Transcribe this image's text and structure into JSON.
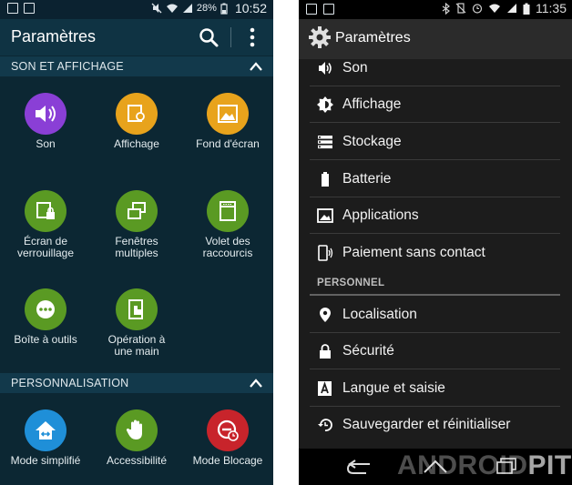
{
  "left": {
    "status": {
      "battery": "28%",
      "time": "10:52"
    },
    "title": "Paramètres",
    "sections": [
      {
        "label": "SON ET AFFICHAGE"
      },
      {
        "label": "PERSONNALISATION"
      }
    ],
    "tiles": [
      {
        "label": "Son",
        "icon": "speaker-icon",
        "color": "#8a3fd6"
      },
      {
        "label": "Affichage",
        "icon": "display-icon",
        "color": "#e8a31c"
      },
      {
        "label": "Fond d'écran",
        "icon": "wallpaper-icon",
        "color": "#e8a31c"
      },
      {
        "label": "Écran de\nverrouillage",
        "icon": "lock-screen-icon",
        "color": "#5a9a23"
      },
      {
        "label": "Fenêtres\nmultiples",
        "icon": "multi-window-icon",
        "color": "#5a9a23"
      },
      {
        "label": "Volet des\nraccourcis",
        "icon": "shortcuts-panel-icon",
        "color": "#5a9a23"
      },
      {
        "label": "Boîte à outils",
        "icon": "toolbox-icon",
        "color": "#5a9a23"
      },
      {
        "label": "Opération à\nune main",
        "icon": "one-hand-icon",
        "color": "#5a9a23"
      },
      {
        "label": "Mode simplifié",
        "icon": "easy-mode-icon",
        "color": "#1f8fd8"
      },
      {
        "label": "Accessibilité",
        "icon": "hand-icon",
        "color": "#5a9a23"
      },
      {
        "label": "Mode Blocage",
        "icon": "block-mode-icon",
        "color": "#c8242b"
      }
    ]
  },
  "right": {
    "status": {
      "time": "11:35"
    },
    "title": "Paramètres",
    "items": [
      {
        "label": "Son",
        "icon": "volume-icon"
      },
      {
        "label": "Affichage",
        "icon": "brightness-icon"
      },
      {
        "label": "Stockage",
        "icon": "storage-icon"
      },
      {
        "label": "Batterie",
        "icon": "battery-icon"
      },
      {
        "label": "Applications",
        "icon": "apps-icon"
      },
      {
        "label": "Paiement sans contact",
        "icon": "nfc-icon"
      }
    ],
    "section_personnel": "PERSONNEL",
    "items2": [
      {
        "label": "Localisation",
        "icon": "location-icon"
      },
      {
        "label": "Sécurité",
        "icon": "lock-icon"
      },
      {
        "label": "Langue et saisie",
        "icon": "language-icon"
      },
      {
        "label": "Sauvegarder et réinitialiser",
        "icon": "backup-icon"
      }
    ],
    "watermark": {
      "part1": "ANDROID",
      "part2": "PIT"
    }
  }
}
